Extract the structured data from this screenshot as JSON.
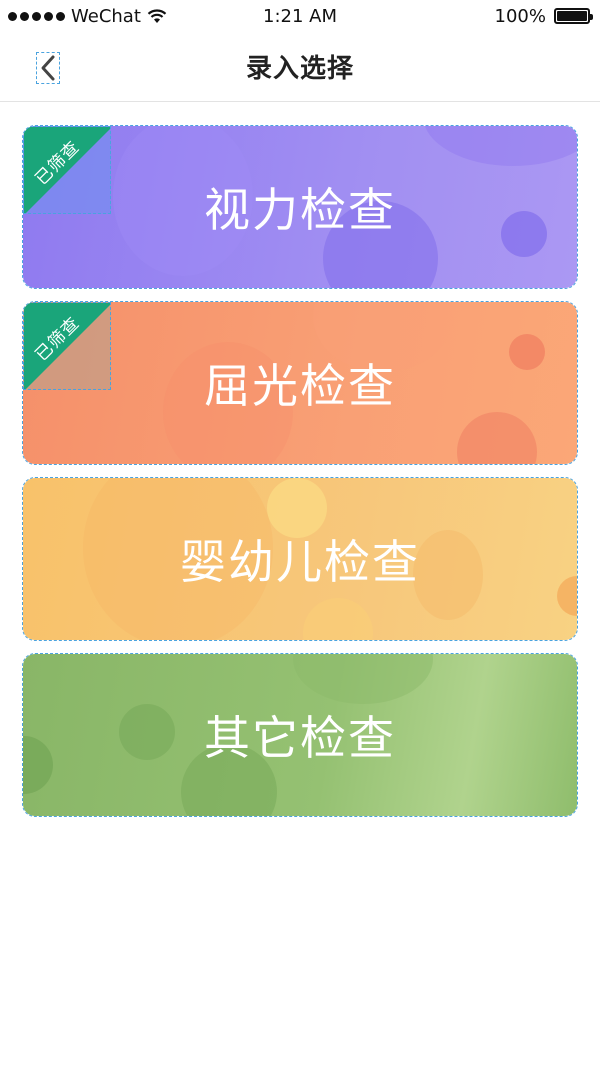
{
  "status_bar": {
    "carrier": "WeChat",
    "time": "1:21 AM",
    "battery": "100%"
  },
  "nav": {
    "title": "录入选择"
  },
  "cards": [
    {
      "label": "视力检查",
      "badge": "已筛查"
    },
    {
      "label": "屈光检查",
      "badge": "已筛查"
    },
    {
      "label": "婴幼儿检查"
    },
    {
      "label": "其它检查"
    }
  ],
  "colors": {
    "badge_green": "#1aa57a",
    "vision_purple": "#9a85f1",
    "refraction_orange": "#f79a70",
    "infant_yellow": "#f8c776",
    "other_green": "#95c172"
  },
  "icons": {
    "back": "chevron-left-icon",
    "wifi": "wifi-icon",
    "battery": "battery-icon",
    "signal": "signal-dots-icon"
  }
}
